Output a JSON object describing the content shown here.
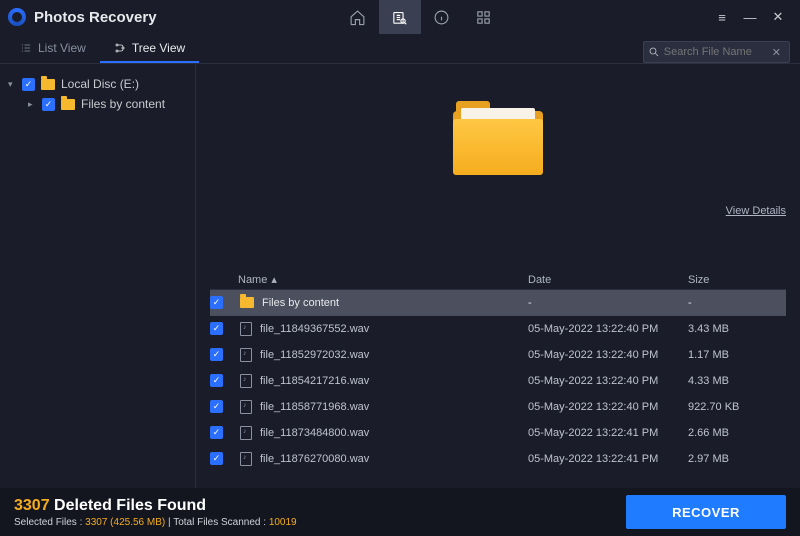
{
  "app": {
    "title": "Photos Recovery"
  },
  "toolbar": {
    "home": "home",
    "scan": "scan",
    "info": "info",
    "grid": "grid"
  },
  "window": {
    "menu": "≡",
    "min": "—",
    "close": "✕"
  },
  "tabs": {
    "list": "List View",
    "tree": "Tree View"
  },
  "search": {
    "placeholder": "Search File Name"
  },
  "tree": {
    "root": "Local Disc (E:)",
    "child": "Files by content"
  },
  "preview": {
    "view_details": "View Details"
  },
  "columns": {
    "name": "Name",
    "date": "Date",
    "size": "Size"
  },
  "rows": [
    {
      "name": "Files by content",
      "date": "-",
      "size": "-",
      "folder": true
    },
    {
      "name": "file_11849367552.wav",
      "date": "05-May-2022 13:22:40 PM",
      "size": "3.43 MB"
    },
    {
      "name": "file_11852972032.wav",
      "date": "05-May-2022 13:22:40 PM",
      "size": "1.17 MB"
    },
    {
      "name": "file_11854217216.wav",
      "date": "05-May-2022 13:22:40 PM",
      "size": "4.33 MB"
    },
    {
      "name": "file_11858771968.wav",
      "date": "05-May-2022 13:22:40 PM",
      "size": "922.70 KB"
    },
    {
      "name": "file_11873484800.wav",
      "date": "05-May-2022 13:22:41 PM",
      "size": "2.66 MB"
    },
    {
      "name": "file_11876270080.wav",
      "date": "05-May-2022 13:22:41 PM",
      "size": "2.97 MB"
    }
  ],
  "footer": {
    "count": "3307",
    "found_label": "Deleted Files Found",
    "selected_label": "Selected Files :",
    "selected_value": "3307 (425.56 MB)",
    "sep": " | ",
    "scanned_label": "Total Files Scanned :",
    "scanned_value": "10019",
    "recover": "RECOVER"
  }
}
